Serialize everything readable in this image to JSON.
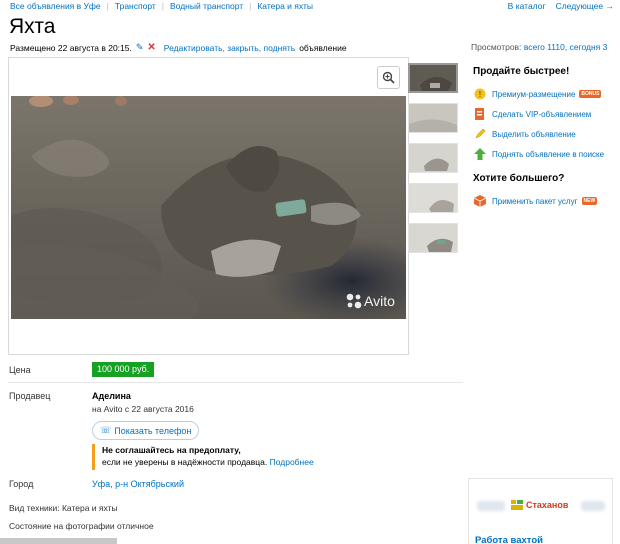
{
  "breadcrumbs": [
    "Все объявления в Уфе",
    "Транспорт",
    "Водный транспорт",
    "Катера и яхты"
  ],
  "top_links": {
    "catalog": "В каталог",
    "next": "Следующее →"
  },
  "title": "Яхта",
  "meta": {
    "posted": "Размещено 22 августа в 20:15.",
    "edit_actions": "Редактировать, закрыть, поднять",
    "edit_suffix": "объявление",
    "views_label": "Просмотров:",
    "views_value": "всего 1110, сегодня 3"
  },
  "gallery": {
    "watermark": "Avito",
    "thumb_count": 5
  },
  "details": {
    "price_label": "Цена",
    "price": "100 000 руб.",
    "seller_label": "Продавец",
    "seller_name": "Аделина",
    "seller_since": "на Avito с 22 августа 2016",
    "phone_button": "Показать телефон",
    "warning_title": "Не соглашайтесь на предоплату,",
    "warning_text": "если не уверены в надёжности продавца.",
    "warning_link": "Подробнее",
    "city_label": "Город",
    "city": "Уфа, р-н Октябрьский",
    "param_type": "Вид техники: Катера и яхты",
    "param_condition": "Состояние на фотографии отличное"
  },
  "sidebar": {
    "sell_faster_title": "Продайте быстрее!",
    "sell_items": [
      {
        "label": "Премиум-размещение",
        "icon": "premium-icon",
        "badge": "BONUS"
      },
      {
        "label": "Сделать VIP-объявлением",
        "icon": "vip-icon"
      },
      {
        "label": "Выделить объявление",
        "icon": "highlight-icon"
      },
      {
        "label": "Поднять объявление в поиске",
        "icon": "arrow-up-icon"
      }
    ],
    "more_title": "Хотите большего?",
    "more_items": [
      {
        "label": "Применить пакет услуг",
        "icon": "package-icon",
        "badge": "NEW"
      }
    ]
  },
  "ad": {
    "brand": "Стаханов",
    "job_link": "Работа вахтой"
  },
  "colors": {
    "link": "#0071c1",
    "price_bg": "#17a124",
    "warning_border": "#f2a01a",
    "badge": "#e8672a"
  }
}
